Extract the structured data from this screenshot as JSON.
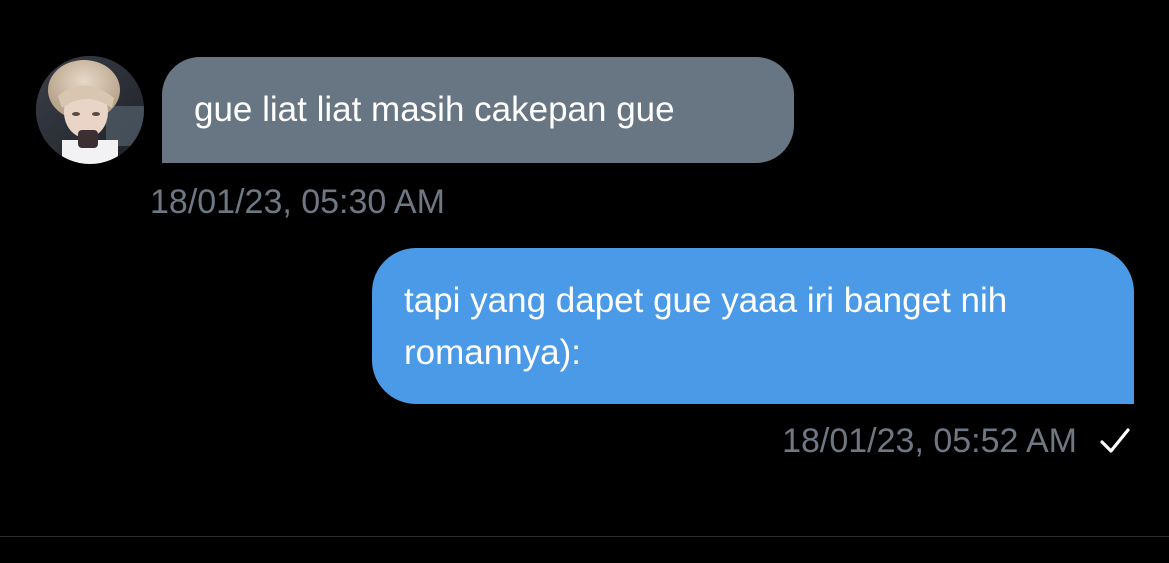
{
  "messages": [
    {
      "direction": "incoming",
      "text": "gue liat liat masih cakepan gue",
      "timestamp": "18/01/23, 05:30 AM",
      "avatar": "user-avatar"
    },
    {
      "direction": "outgoing",
      "text": "tapi yang dapet gue yaaa iri banget nih romannya):",
      "timestamp": "18/01/23, 05:52 AM",
      "status_icon": "checkmark-icon"
    }
  ],
  "colors": {
    "background": "#000000",
    "incoming_bubble": "#687582",
    "outgoing_bubble": "#4b9ae8",
    "timestamp": "#6e7884",
    "text": "#ffffff"
  }
}
